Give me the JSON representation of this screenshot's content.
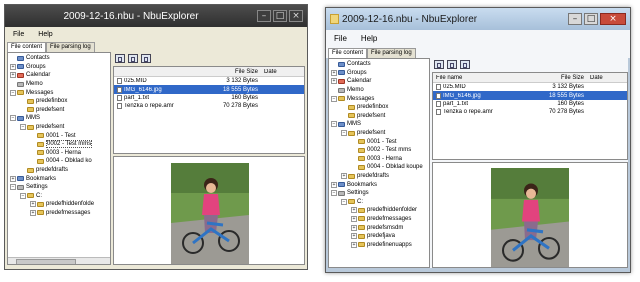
{
  "left_window": {
    "title": "2009-12-16.nbu - NbuExplorer",
    "menu": [
      "File",
      "Help"
    ],
    "tabs": [
      {
        "label": "File content"
      },
      {
        "label": "File parsing log"
      }
    ],
    "tree": [
      {
        "label": "Contacts",
        "icon": "contacts-icon"
      },
      {
        "label": "Groups",
        "icon": "groups-icon"
      },
      {
        "label": "Calendar",
        "icon": "calendar-icon"
      },
      {
        "label": "Memo",
        "icon": "memo-icon"
      },
      {
        "label": "Messages",
        "icon": "messages-icon"
      },
      {
        "label": "predefinbox",
        "icon": "folder-icon"
      },
      {
        "label": "predefsent",
        "icon": "folder-icon"
      },
      {
        "label": "MMS",
        "icon": "mms-icon"
      },
      {
        "label": "predefsent",
        "icon": "folder-icon"
      },
      {
        "label": "0001 - Test",
        "icon": "folder-icon"
      },
      {
        "label": "0002 - Test mms",
        "icon": "folder-icon"
      },
      {
        "label": "0003 - Herna",
        "icon": "folder-icon"
      },
      {
        "label": "0004 - Obklad ko",
        "icon": "folder-icon"
      },
      {
        "label": "predefdrafts",
        "icon": "folder-icon"
      },
      {
        "label": "Bookmarks",
        "icon": "bookmarks-icon"
      },
      {
        "label": "Settings",
        "icon": "settings-icon"
      },
      {
        "label": "C:",
        "icon": "folder-icon"
      },
      {
        "label": "predefhiddenfolde",
        "icon": "folder-icon"
      },
      {
        "label": "predefmessages",
        "icon": "folder-icon"
      }
    ],
    "columns": {
      "name": "File name",
      "size": "File Size",
      "date": "Date"
    },
    "files": [
      {
        "name": "025.MID",
        "size": "3 132 Bytes"
      },
      {
        "name": "IMG_6146.jpg",
        "size": "18 555 Bytes"
      },
      {
        "name": "part_1.txt",
        "size": "160 Bytes"
      },
      {
        "name": "Tenzka o repe.amr",
        "size": "70 278 Bytes"
      }
    ]
  },
  "right_window": {
    "title": "2009-12-16.nbu - NbuExplorer",
    "menu": [
      "File",
      "Help"
    ],
    "tabs": [
      {
        "label": "File content"
      },
      {
        "label": "File parsing log"
      }
    ],
    "tree": [
      {
        "label": "Contacts",
        "icon": "contacts-icon"
      },
      {
        "label": "Groups",
        "icon": "groups-icon"
      },
      {
        "label": "Calendar",
        "icon": "calendar-icon"
      },
      {
        "label": "Memo",
        "icon": "memo-icon"
      },
      {
        "label": "Messages",
        "icon": "messages-icon"
      },
      {
        "label": "predefinbox",
        "icon": "folder-icon"
      },
      {
        "label": "predefsent",
        "icon": "folder-icon"
      },
      {
        "label": "MMS",
        "icon": "mms-icon"
      },
      {
        "label": "predefsent",
        "icon": "folder-icon"
      },
      {
        "label": "0001 - Test",
        "icon": "folder-icon"
      },
      {
        "label": "0002 - Test mms",
        "icon": "folder-icon"
      },
      {
        "label": "0003 - Herna",
        "icon": "folder-icon"
      },
      {
        "label": "0004 - Obklad koupe",
        "icon": "folder-icon"
      },
      {
        "label": "predefdrafts",
        "icon": "folder-icon"
      },
      {
        "label": "Bookmarks",
        "icon": "bookmarks-icon"
      },
      {
        "label": "Settings",
        "icon": "settings-icon"
      },
      {
        "label": "C:",
        "icon": "folder-icon"
      },
      {
        "label": "predefhiddenfolder",
        "icon": "folder-icon"
      },
      {
        "label": "predefmessages",
        "icon": "folder-icon"
      },
      {
        "label": "predefsmsdm",
        "icon": "folder-icon"
      },
      {
        "label": "predefjava",
        "icon": "folder-icon"
      },
      {
        "label": "predefinenuapps",
        "icon": "folder-icon"
      }
    ],
    "columns": {
      "name": "File name",
      "size": "File Size",
      "date": "Date"
    },
    "files": [
      {
        "name": "025.MID",
        "size": "3 132 Bytes"
      },
      {
        "name": "IMG_6146.jpg",
        "size": "18 555 Bytes"
      },
      {
        "name": "part_1.txt",
        "size": "160 Bytes"
      },
      {
        "name": "Tenzka o repe.amr",
        "size": "70 278 Bytes"
      }
    ]
  }
}
